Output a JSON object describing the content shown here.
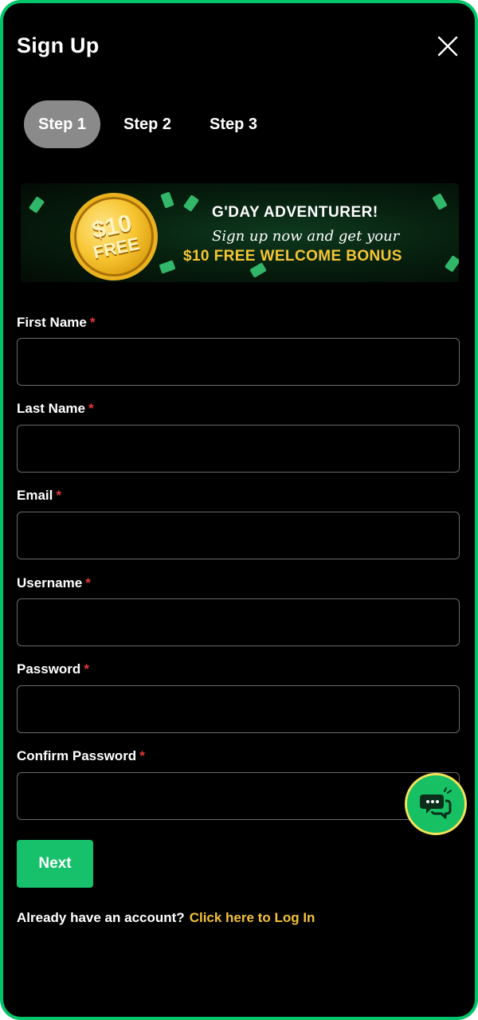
{
  "header": {
    "title": "Sign Up"
  },
  "steps": [
    {
      "label": "Step 1",
      "active": true
    },
    {
      "label": "Step 2",
      "active": false
    },
    {
      "label": "Step 3",
      "active": false
    }
  ],
  "banner": {
    "coin_amount": "$10",
    "coin_text": "FREE",
    "headline": "G'DAY ADVENTURER!",
    "subline": "Sign up now and get your",
    "bonus": "$10 FREE WELCOME BONUS"
  },
  "form": {
    "required_marker": "*",
    "fields": [
      {
        "label": "First Name",
        "value": ""
      },
      {
        "label": "Last Name",
        "value": ""
      },
      {
        "label": "Email",
        "value": ""
      },
      {
        "label": "Username",
        "value": ""
      },
      {
        "label": "Password",
        "value": ""
      },
      {
        "label": "Confirm Password",
        "value": ""
      }
    ],
    "next_label": "Next"
  },
  "footer": {
    "prompt": "Already have an account?",
    "link": "Click here to Log In"
  },
  "icons": {
    "close": "close-icon",
    "chat": "chat-bubbles-icon"
  },
  "colors": {
    "accent": "#17c06a",
    "link": "#f3c13a",
    "required": "#e53935",
    "active_step": "#8a8a8a"
  }
}
